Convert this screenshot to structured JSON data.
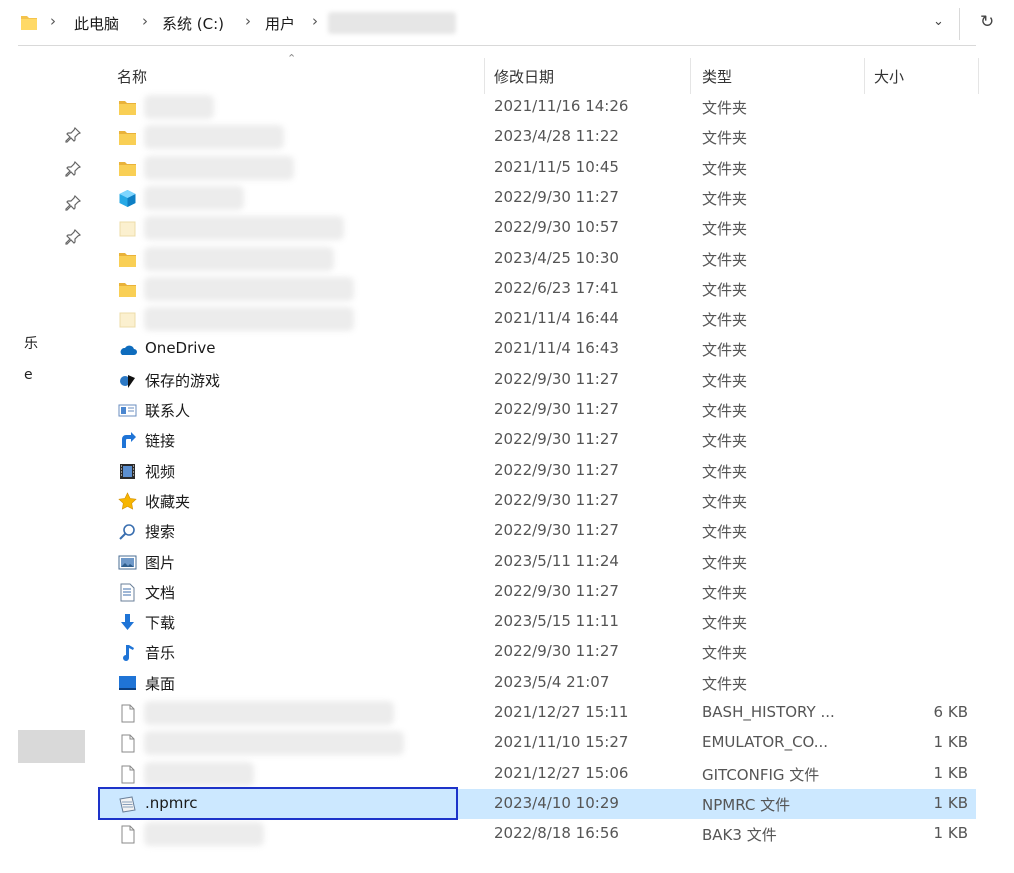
{
  "address_bar": {
    "crumbs": [
      "此电脑",
      "系统 (C:)",
      "用户"
    ],
    "separator": "›",
    "dropdown_icon": "chevron-down-icon",
    "refresh_icon": "refresh-icon"
  },
  "left_fragments": [
    "乐",
    "e"
  ],
  "columns": {
    "name": "名称",
    "modified": "修改日期",
    "type": "类型",
    "size": "大小"
  },
  "rows": [
    {
      "icon": "folder",
      "name": "",
      "date": "2021/11/16 14:26",
      "type": "文件夹",
      "size": ""
    },
    {
      "icon": "folder",
      "name": "",
      "date": "2023/4/28 11:22",
      "type": "文件夹",
      "size": ""
    },
    {
      "icon": "folder",
      "name": "",
      "date": "2021/11/5 10:45",
      "type": "文件夹",
      "size": ""
    },
    {
      "icon": "3d-objects",
      "name": "",
      "date": "2022/9/30 11:27",
      "type": "文件夹",
      "size": ""
    },
    {
      "icon": "folder-light",
      "name": "",
      "date": "2022/9/30 10:57",
      "type": "文件夹",
      "size": ""
    },
    {
      "icon": "folder",
      "name": "",
      "date": "2023/4/25 10:30",
      "type": "文件夹",
      "size": ""
    },
    {
      "icon": "folder",
      "name": "",
      "date": "2022/6/23 17:41",
      "type": "文件夹",
      "size": ""
    },
    {
      "icon": "folder-light",
      "name": "",
      "date": "2021/11/4 16:44",
      "type": "文件夹",
      "size": ""
    },
    {
      "icon": "onedrive",
      "name": "OneDrive",
      "date": "2021/11/4 16:43",
      "type": "文件夹",
      "size": ""
    },
    {
      "icon": "saved-games",
      "name": "保存的游戏",
      "date": "2022/9/30 11:27",
      "type": "文件夹",
      "size": ""
    },
    {
      "icon": "contacts",
      "name": "联系人",
      "date": "2022/9/30 11:27",
      "type": "文件夹",
      "size": ""
    },
    {
      "icon": "links",
      "name": "链接",
      "date": "2022/9/30 11:27",
      "type": "文件夹",
      "size": ""
    },
    {
      "icon": "videos",
      "name": "视频",
      "date": "2022/9/30 11:27",
      "type": "文件夹",
      "size": ""
    },
    {
      "icon": "favorites",
      "name": "收藏夹",
      "date": "2022/9/30 11:27",
      "type": "文件夹",
      "size": ""
    },
    {
      "icon": "searches",
      "name": "搜索",
      "date": "2022/9/30 11:27",
      "type": "文件夹",
      "size": ""
    },
    {
      "icon": "pictures",
      "name": "图片",
      "date": "2023/5/11 11:24",
      "type": "文件夹",
      "size": ""
    },
    {
      "icon": "documents",
      "name": "文档",
      "date": "2022/9/30 11:27",
      "type": "文件夹",
      "size": ""
    },
    {
      "icon": "downloads",
      "name": "下载",
      "date": "2023/5/15 11:11",
      "type": "文件夹",
      "size": ""
    },
    {
      "icon": "music",
      "name": "音乐",
      "date": "2022/9/30 11:27",
      "type": "文件夹",
      "size": ""
    },
    {
      "icon": "desktop",
      "name": "桌面",
      "date": "2023/5/4 21:07",
      "type": "文件夹",
      "size": ""
    },
    {
      "icon": "file",
      "name": "",
      "date": "2021/12/27 15:11",
      "type": "BASH_HISTORY ...",
      "size": "6 KB"
    },
    {
      "icon": "file",
      "name": "",
      "date": "2021/11/10 15:27",
      "type": "EMULATOR_CO...",
      "size": "1 KB"
    },
    {
      "icon": "file",
      "name": "",
      "date": "2021/12/27 15:06",
      "type": "GITCONFIG 文件",
      "size": "1 KB"
    },
    {
      "icon": "text-file",
      "name": ".npmrc",
      "date": "2023/4/10 10:29",
      "type": "NPMRC 文件",
      "size": "1 KB",
      "selected": true
    },
    {
      "icon": "file",
      "name": "",
      "date": "2022/8/18 16:56",
      "type": "BAK3 文件",
      "size": "1 KB"
    }
  ],
  "colors": {
    "selection": "#cce8ff",
    "focus_border": "#1d33c9",
    "folder": "#f4c34c"
  }
}
